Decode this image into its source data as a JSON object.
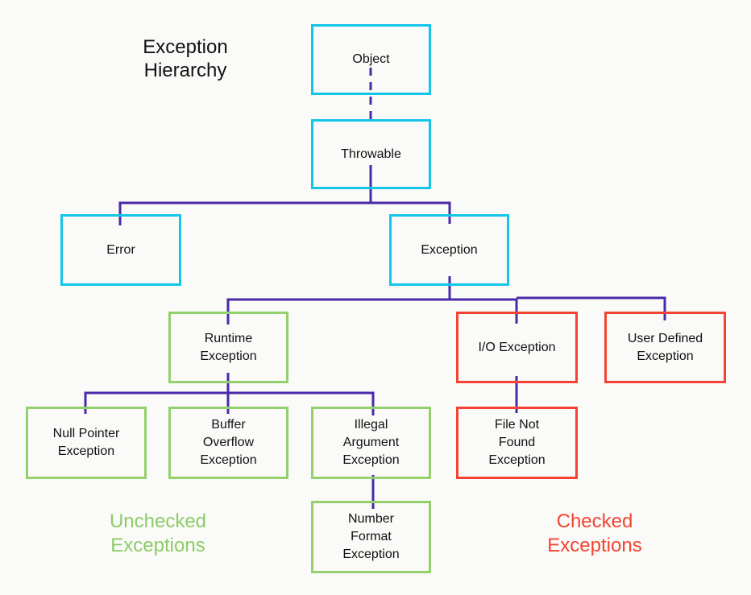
{
  "title": "Exception\nHierarchy",
  "colors": {
    "base_border": "#12c6ea",
    "unchecked_border": "#94d06c",
    "checked_border": "#f44331",
    "connector": "#4b2aa8",
    "background": "#fafaf8"
  },
  "nodes": {
    "object": "Object",
    "throwable": "Throwable",
    "error": "Error",
    "exception": "Exception",
    "runtime": "Runtime\nException",
    "io": "I/O Exception",
    "user_defined": "User Defined\nException",
    "null_pointer": "Null Pointer\nException",
    "buffer_overflow": "Buffer\nOverflow\nException",
    "illegal_argument": "Illegal\nArgument\nException",
    "number_format": "Number\nFormat\nException",
    "file_not_found": "File Not\nFound\nException"
  },
  "edges": [
    {
      "from": "object",
      "to": "throwable",
      "style": "dashed"
    },
    {
      "from": "throwable",
      "to": "error",
      "style": "solid"
    },
    {
      "from": "throwable",
      "to": "exception",
      "style": "solid"
    },
    {
      "from": "exception",
      "to": "runtime",
      "style": "solid"
    },
    {
      "from": "exception",
      "to": "io",
      "style": "solid"
    },
    {
      "from": "exception",
      "to": "user_defined",
      "style": "solid"
    },
    {
      "from": "runtime",
      "to": "null_pointer",
      "style": "solid"
    },
    {
      "from": "runtime",
      "to": "buffer_overflow",
      "style": "solid"
    },
    {
      "from": "runtime",
      "to": "illegal_argument",
      "style": "solid"
    },
    {
      "from": "illegal_argument",
      "to": "number_format",
      "style": "solid"
    },
    {
      "from": "io",
      "to": "file_not_found",
      "style": "solid"
    }
  ],
  "captions": {
    "unchecked": "Unchecked\nExceptions",
    "checked": "Checked\nExceptions"
  }
}
